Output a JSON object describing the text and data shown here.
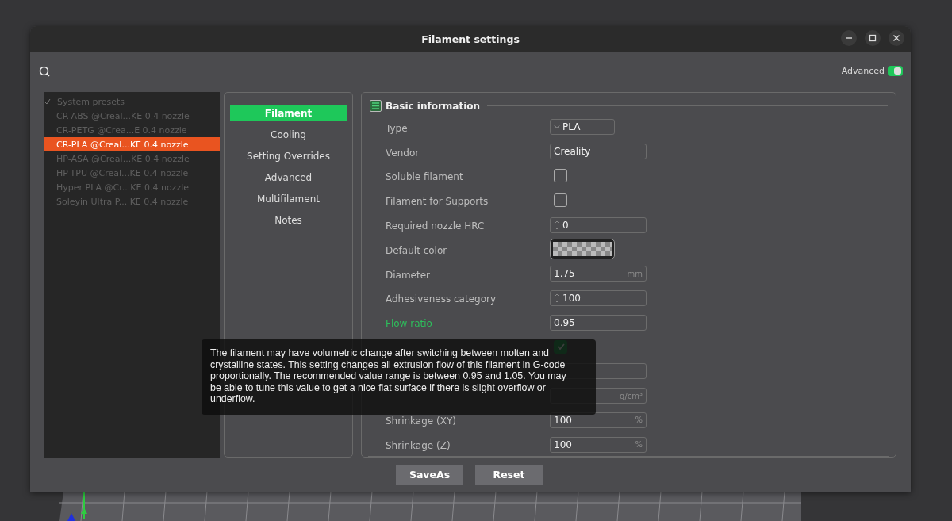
{
  "window": {
    "title": "Filament settings"
  },
  "advanced_toggle": {
    "label": "Advanced",
    "on": true
  },
  "presets": [
    {
      "label": "System presets",
      "expanded": true,
      "children": [
        {
          "label": "CR-ABS @Creal...KE 0.4 nozzle",
          "selected": false
        },
        {
          "label": "CR-PETG @Crea...E 0.4 nozzle",
          "selected": false
        },
        {
          "label": "CR-PLA @Creal...KE 0.4 nozzle",
          "selected": true
        },
        {
          "label": "HP-ASA @Creal...KE 0.4 nozzle",
          "selected": false
        },
        {
          "label": "HP-TPU @Creal...KE 0.4 nozzle",
          "selected": false
        },
        {
          "label": "Hyper PLA @Cr...KE 0.4 nozzle",
          "selected": false
        },
        {
          "label": "Soleyin Ultra P... KE 0.4 nozzle",
          "selected": false
        }
      ]
    }
  ],
  "tabs": [
    {
      "label": "Filament",
      "selected": true
    },
    {
      "label": "Cooling",
      "selected": false
    },
    {
      "label": "Setting Overrides",
      "selected": false
    },
    {
      "label": "Advanced",
      "selected": false
    },
    {
      "label": "Multifilament",
      "selected": false
    },
    {
      "label": "Notes",
      "selected": false
    }
  ],
  "section": {
    "title": "Basic information"
  },
  "options": [
    {
      "kind": "select",
      "label": "Type",
      "value": "PLA",
      "modified": false
    },
    {
      "kind": "text",
      "label": "Vendor",
      "value": "Creality",
      "modified": false
    },
    {
      "kind": "checkbox",
      "label": "Soluble filament",
      "checked": false,
      "modified": false
    },
    {
      "kind": "checkbox",
      "label": "Filament for Supports",
      "checked": false,
      "modified": false
    },
    {
      "kind": "spin",
      "label": "Required nozzle HRC",
      "value": "0",
      "modified": false
    },
    {
      "kind": "color",
      "label": "Default color",
      "modified": false
    },
    {
      "kind": "text",
      "label": "Diameter",
      "value": "1.75",
      "unit": "mm",
      "modified": false
    },
    {
      "kind": "spin",
      "label": "Adhesiveness category",
      "value": "100",
      "modified": false
    },
    {
      "kind": "text",
      "label": "Flow ratio",
      "value": "0.95",
      "modified": true
    },
    {
      "kind": "checkbox",
      "checked": true
    },
    {
      "kind": "text"
    },
    {
      "kind": "text",
      "unit": "g/cm³"
    },
    {
      "kind": "text",
      "label": "Shrinkage (XY)",
      "value": "100",
      "unit": "%",
      "modified": false
    },
    {
      "kind": "text",
      "label": "Shrinkage (Z)",
      "value": "100",
      "unit": "%",
      "modified": false
    }
  ],
  "tooltip": {
    "text": "The filament may have volumetric change after switching between molten and crystalline states. This setting changes all extrusion flow of this filament in G-code proportionally. The recommended value range is between 0.95 and 1.05. You may be able to tune this value to get a nice flat surface if there is slight overflow or underflow."
  },
  "buttons": [
    "SaveAs",
    "Reset"
  ]
}
